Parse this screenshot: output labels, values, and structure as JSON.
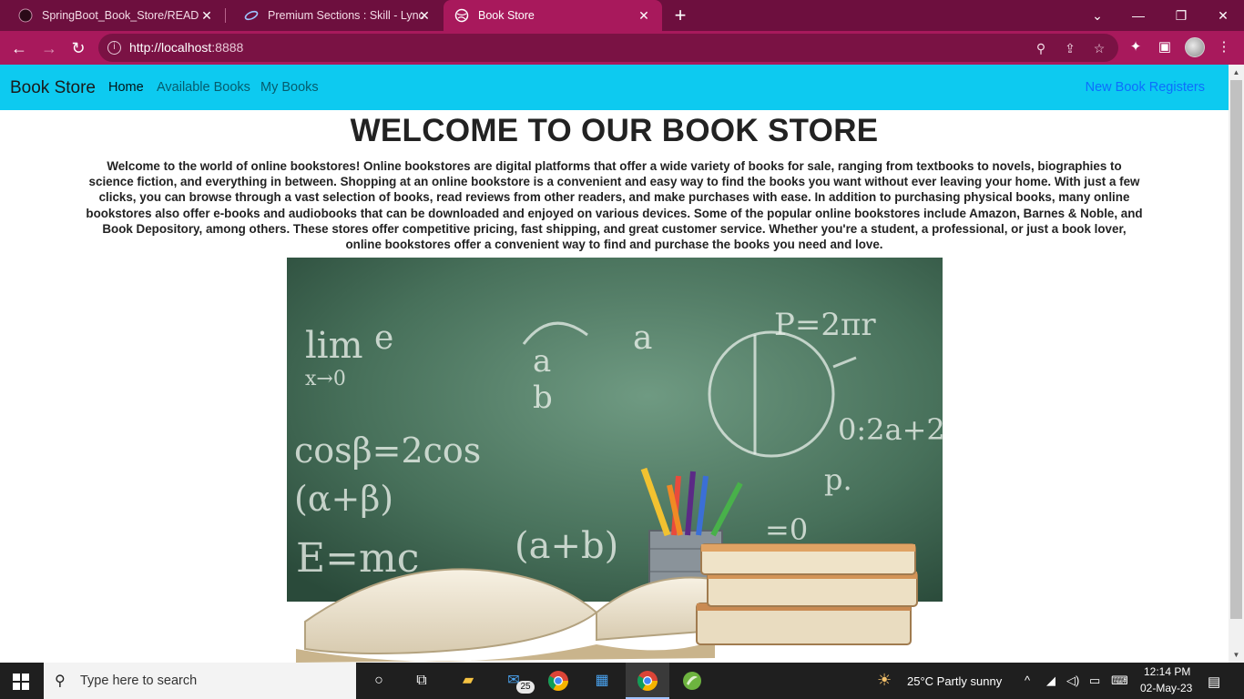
{
  "browser": {
    "tabs": [
      {
        "title": "SpringBoot_Book_Store/README",
        "active": false
      },
      {
        "title": "Premium Sections : Skill - Lync",
        "active": false
      },
      {
        "title": "Book Store",
        "active": true
      }
    ],
    "url_host": "http://localhost",
    "url_port": ":8888"
  },
  "navbar": {
    "brand": "Book Store",
    "links": [
      "Home",
      "Available Books",
      "My Books"
    ],
    "right_link": "New Book Registers"
  },
  "main": {
    "heading": "WELCOME TO OUR BOOK STORE",
    "intro": "Welcome to the world of online bookstores! Online bookstores are digital platforms that offer a wide variety of books for sale, ranging from textbooks to novels, biographies to science fiction, and everything in between. Shopping at an online bookstore is a convenient and easy way to find the books you want without ever leaving your home. With just a few clicks, you can browse through a vast selection of books, read reviews from other readers, and make purchases with ease. In addition to purchasing physical books, many online bookstores also offer e-books and audiobooks that can be downloaded and enjoyed on various devices. Some of the popular online bookstores include Amazon, Barnes & Noble, and Book Depository, among others. These stores offer competitive pricing, fast shipping, and great customer service. Whether you're a student, a professional, or just a book lover, online bookstores offer a convenient way to find and purchase the books you need and love.",
    "chalkboard_texts": [
      "lim",
      "e",
      "x→0",
      "a",
      "b",
      "a",
      "P=2πr",
      "cosβ=2cos",
      "(α+β)",
      "E=mc",
      "(a+b)",
      "0:2a+2",
      "p.",
      "=0"
    ]
  },
  "taskbar": {
    "search_placeholder": "Type here to search",
    "mail_badge": "25",
    "weather": "25°C  Partly sunny",
    "time": "12:14 PM",
    "date": "02-May-23"
  },
  "colors": {
    "tab_strip": "#6d0f3e",
    "toolbar": "#a8195c",
    "navbar": "#0dcaf0",
    "link_blue": "#0d6efd"
  }
}
